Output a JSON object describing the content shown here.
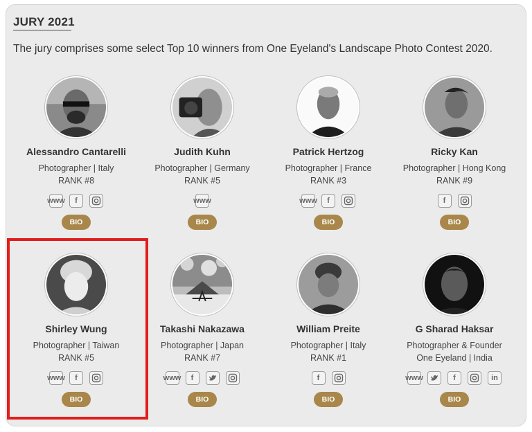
{
  "section": {
    "title": "JURY 2021",
    "intro": "The jury comprises some select Top 10 winners from One Eyeland's Landscape Photo Contest 2020."
  },
  "bio_label": "BIO",
  "jurors": [
    {
      "name": "Alessandro Cantarelli",
      "role": "Photographer | Italy",
      "rank": "RANK #8",
      "socials": [
        "website-icon",
        "facebook-icon",
        "instagram-icon"
      ]
    },
    {
      "name": "Judith Kuhn",
      "role": "Photographer | Germany",
      "rank": "RANK #5",
      "socials": [
        "website-icon"
      ]
    },
    {
      "name": "Patrick Hertzog",
      "role": "Photographer | France",
      "rank": "RANK #3",
      "socials": [
        "website-icon",
        "facebook-icon",
        "instagram-icon"
      ]
    },
    {
      "name": "Ricky Kan",
      "role": "Photographer | Hong Kong",
      "rank": "RANK #9",
      "socials": [
        "facebook-icon",
        "instagram-icon"
      ]
    },
    {
      "name": "Shirley Wung",
      "role": "Photographer | Taiwan",
      "rank": "RANK #5",
      "socials": [
        "website-icon",
        "facebook-icon",
        "instagram-icon"
      ]
    },
    {
      "name": "Takashi Nakazawa",
      "role": "Photographer | Japan",
      "rank": "RANK #7",
      "socials": [
        "website-icon",
        "facebook-icon",
        "twitter-icon",
        "instagram-icon"
      ]
    },
    {
      "name": "William Preite",
      "role": "Photographer | Italy",
      "rank": "RANK #1",
      "socials": [
        "facebook-icon",
        "instagram-icon"
      ]
    },
    {
      "name": "G Sharad Haksar",
      "role": "Photographer & Founder",
      "rank": "One Eyeland | India",
      "socials": [
        "website-icon",
        "twitter-icon",
        "facebook-icon",
        "instagram-icon",
        "linkedin-icon"
      ]
    }
  ],
  "highlight_color": "#e21d1d",
  "accent_color": "#a9874b"
}
